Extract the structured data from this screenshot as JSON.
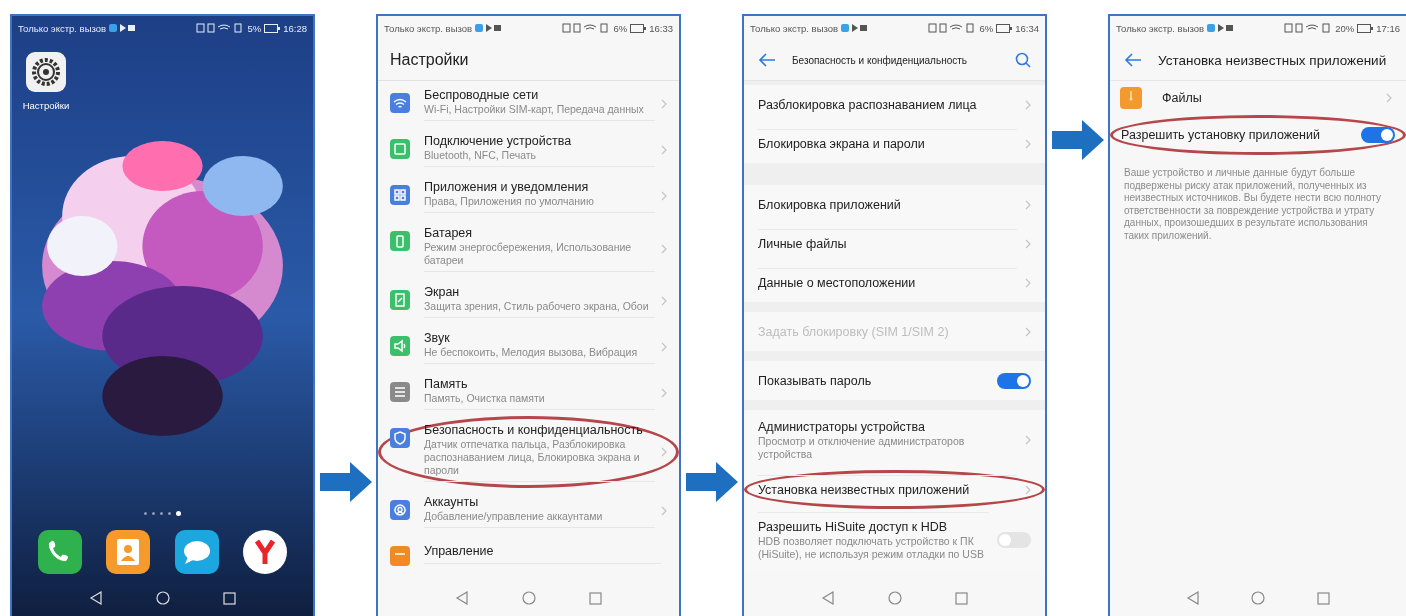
{
  "screens": [
    {
      "kind": "home",
      "status_bar": {
        "carrier": "Только экстр. вызов",
        "battery": "5%",
        "time": "16:28"
      },
      "apps": [
        {
          "label": "Настройки"
        }
      ],
      "page_dots": [
        {
          "selected": false
        },
        {
          "selected": false
        },
        {
          "selected": false
        },
        {
          "selected": false
        },
        {
          "selected": true
        }
      ]
    },
    {
      "kind": "settings",
      "status_bar": {
        "carrier": "Только экстр. вызов",
        "battery": "6%",
        "time": "16:33"
      },
      "title": "Настройки",
      "items": [
        {
          "kind": "wifi",
          "color": "#4a7fe0",
          "title": "Беспроводные сети",
          "subtitle": "Wi-Fi, Настройки SIM-карт, Передача данных",
          "highlighted": false
        },
        {
          "kind": "devices",
          "color": "#3cbf6a",
          "title": "Подключение устройства",
          "subtitle": "Bluetooth, NFC, Печать",
          "highlighted": false
        },
        {
          "kind": "apps",
          "color": "#4a7fe0",
          "title": "Приложения и уведомления",
          "subtitle": "Права, Приложения по умолчанию",
          "highlighted": false
        },
        {
          "kind": "battery",
          "color": "#3cbf6a",
          "title": "Батарея",
          "subtitle": "Режим энергосбережения, Использование батареи",
          "highlighted": false
        },
        {
          "kind": "display",
          "color": "#3cbf6a",
          "title": "Экран",
          "subtitle": "Защита зрения, Стиль рабочего экрана, Обои",
          "highlighted": false
        },
        {
          "kind": "sound",
          "color": "#3cbf6a",
          "title": "Звук",
          "subtitle": "Не беспокоить, Мелодия вызова, Вибрация",
          "highlighted": false
        },
        {
          "kind": "storage",
          "color": "#8a8a8a",
          "title": "Память",
          "subtitle": "Память, Очистка памяти",
          "highlighted": false
        },
        {
          "kind": "security",
          "color": "#4a7fe0",
          "title": "Безопасность и конфиденциальность",
          "subtitle": "Датчик отпечатка пальца, Разблокировка распознаванием лица, Блокировка экрана и пароли",
          "highlighted": true
        },
        {
          "kind": "accounts",
          "color": "#4a7fe0",
          "title": "Аккаунты",
          "subtitle": "Добавление/управление аккаунтами",
          "highlighted": false
        },
        {
          "kind": "manage",
          "color": "#f08a24",
          "title": "Управление",
          "highlighted": false
        }
      ]
    },
    {
      "kind": "security",
      "status_bar": {
        "carrier": "Только экстр. вызов",
        "battery": "6%",
        "time": "16:34"
      },
      "title": "Безопасность и конфиденциальность",
      "groups": [
        {
          "rows": [
            {
              "kind": "link",
              "title": "Разблокировка распознаванием лица",
              "disabled": false,
              "highlighted": false
            },
            {
              "kind": "link",
              "title": "Блокировка экрана и пароли",
              "disabled": false,
              "highlighted": false
            }
          ]
        },
        {
          "rows": [
            {
              "kind": "link",
              "title": "Блокировка приложений",
              "disabled": false,
              "highlighted": false
            },
            {
              "kind": "link",
              "title": "Личные файлы",
              "disabled": false,
              "highlighted": false
            },
            {
              "kind": "link",
              "title": "Данные о местоположении",
              "disabled": false,
              "highlighted": false
            }
          ]
        },
        {
          "rows": [
            {
              "kind": "link",
              "title": "Задать блокировку (SIM 1/SIM 2)",
              "disabled": true,
              "highlighted": false
            }
          ]
        },
        {
          "rows": [
            {
              "kind": "toggle",
              "title": "Показывать пароль",
              "on": true,
              "highlighted": false
            }
          ]
        },
        {
          "rows": [
            {
              "kind": "link",
              "title": "Администраторы устройства",
              "subtitle": "Просмотр и отключение администраторов устройства",
              "disabled": false,
              "highlighted": false
            },
            {
              "kind": "link",
              "title": "Установка неизвестных приложений",
              "disabled": false,
              "highlighted": true
            },
            {
              "kind": "toggle",
              "title": "Разрешить HiSuite доступ к HDB",
              "subtitle": "HDB позволяет подключать устройство к ПК (HiSuite), не используя режим отладки по USB",
              "on": false,
              "highlighted": false
            }
          ]
        }
      ]
    },
    {
      "kind": "install",
      "status_bar": {
        "carrier": "Только экстр. вызов",
        "battery": "20%",
        "time": "17:16"
      },
      "title": "Установка неизвестных приложений",
      "app": {
        "title": "Файлы",
        "color": "#f29a2e"
      },
      "toggle": {
        "title": "Разрешить установку приложений",
        "on": true,
        "highlighted": true
      },
      "note": "Ваше устройство и личные данные будут больше подвержены риску атак приложений, полученных из неизвестных источников. Вы будете нести всю полноту ответственности за повреждение устройства и утрату данных, произошедших в результате использования таких приложений."
    }
  ]
}
